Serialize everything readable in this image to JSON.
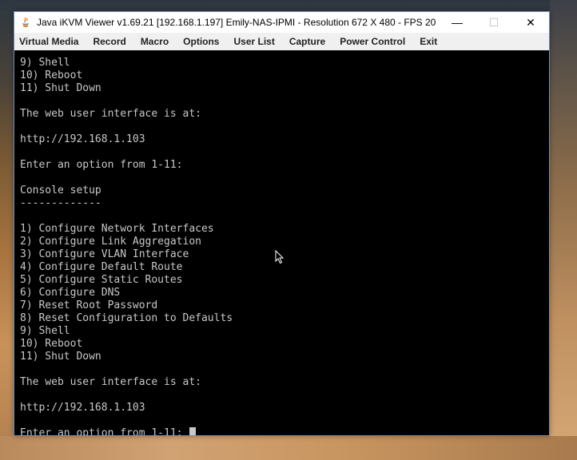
{
  "window": {
    "title": "Java iKVM Viewer v1.69.21 [192.168.1.197] Emily-NAS-IPMI - Resolution 672 X 480 - FPS 20",
    "controls": {
      "minimize": "—",
      "maximize": "☐",
      "close": "✕"
    }
  },
  "menu": [
    "Virtual Media",
    "Record",
    "Macro",
    "Options",
    "User List",
    "Capture",
    "Power Control",
    "Exit"
  ],
  "console": {
    "lines": [
      "9) Shell",
      "10) Reboot",
      "11) Shut Down",
      "",
      "The web user interface is at:",
      "",
      "http://192.168.1.103",
      "",
      "Enter an option from 1-11:",
      "",
      "Console setup",
      "-------------",
      "",
      "1) Configure Network Interfaces",
      "2) Configure Link Aggregation",
      "3) Configure VLAN Interface",
      "4) Configure Default Route",
      "5) Configure Static Routes",
      "6) Configure DNS",
      "7) Reset Root Password",
      "8) Reset Configuration to Defaults",
      "9) Shell",
      "10) Reboot",
      "11) Shut Down",
      "",
      "The web user interface is at:",
      "",
      "http://192.168.1.103",
      ""
    ],
    "prompt": "Enter an option from 1-11: "
  },
  "colors": {
    "console_bg": "#000000",
    "console_text": "#c8c8c8",
    "menubar_bg": "#f0f0f0"
  }
}
